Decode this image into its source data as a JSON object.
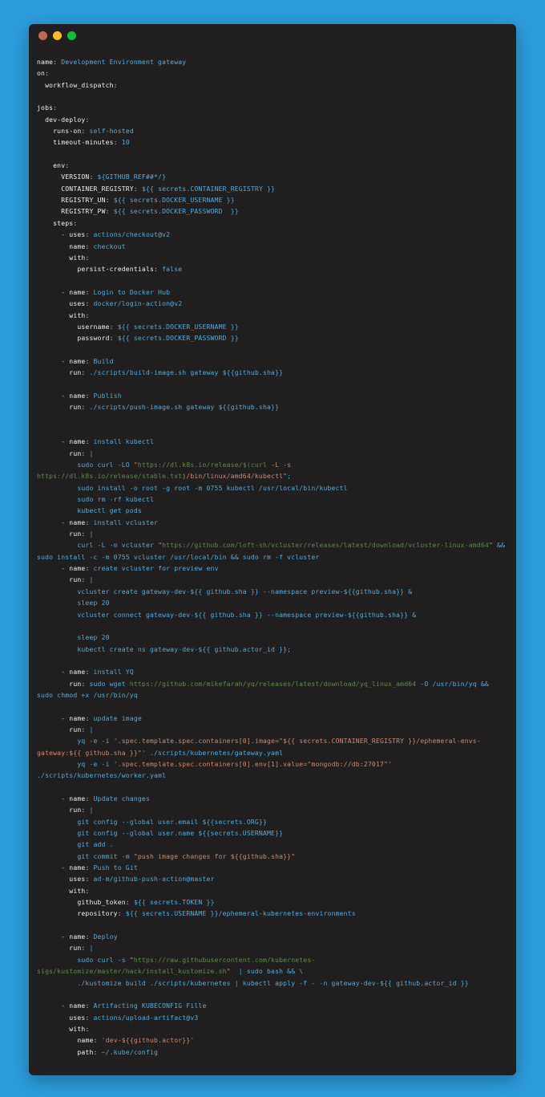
{
  "window": {
    "title": "",
    "traffic_lights": [
      {
        "name": "close-button",
        "color": "#b96a5a"
      },
      {
        "name": "minimize-button",
        "color": "#f5bd1f"
      },
      {
        "name": "maximize-button",
        "color": "#0fbd37"
      }
    ],
    "background_color": "#2d9cdb",
    "code_background_color": "#211f1f"
  },
  "colors": {
    "accent_blue": "#2d9cdb",
    "key": "#e8eef2",
    "value": "#57a8d8",
    "string": "#c98a6f",
    "url": "#5d8a4a",
    "plain": "#b9c2c9"
  },
  "code": {
    "language": "yaml",
    "filename": "",
    "lines": [
      "name: Development Environment gateway",
      "on:",
      "  workflow_dispatch:",
      "",
      "jobs:",
      "  dev-deploy:",
      "    runs-on: self-hosted",
      "    timeout-minutes: 10",
      "",
      "    env:",
      "      VERSION: ${GITHUB_REF##*/}",
      "      CONTAINER_REGISTRY: ${{ secrets.CONTAINER_REGISTRY }}",
      "      REGISTRY_UN: ${{ secrets.DOCKER_USERNAME }}",
      "      REGISTRY_PW: ${{ secrets.DOCKER_PASSWORD  }}",
      "    steps:",
      "      - uses: actions/checkout@v2",
      "        name: checkout",
      "        with:",
      "          persist-credentials: false",
      "",
      "      - name: Login to Docker Hub",
      "        uses: docker/login-action@v2",
      "        with:",
      "          username: ${{ secrets.DOCKER_USERNAME }}",
      "          password: ${{ secrets.DOCKER_PASSWORD }}",
      "",
      "      - name: Build",
      "        run: ./scripts/build-image.sh gateway ${{github.sha}}",
      "",
      "      - name: Publish",
      "        run: ./scripts/push-image.sh gateway ${{github.sha}}",
      "",
      "",
      "      - name: install kubectl",
      "        run: |",
      "          sudo curl -LO \"https://dl.k8s.io/release/$(curl -L -s https://dl.k8s.io/release/stable.txt)/bin/linux/amd64/kubectl\";",
      "          sudo install -o root -g root -m 0755 kubectl /usr/local/bin/kubectl",
      "          sudo rm -rf kubectl",
      "          kubectl get pods",
      "      - name: install vcluster",
      "        run: |",
      "          curl -L -o vcluster \"https://github.com/loft-sh/vcluster/releases/latest/download/vcluster-linux-amd64\" && sudo install -c -m 0755 vcluster /usr/local/bin && sudo rm -f vcluster",
      "      - name: create vcluster for preview env",
      "        run: |",
      "          vcluster create gateway-dev-${{ github.sha }} --namespace preview-${{github.sha}} &",
      "          sleep 20",
      "          vcluster connect gateway-dev-${{ github.sha }} --namespace preview-${{github.sha}} &",
      "",
      "          sleep 20",
      "          kubectl create ns gateway-dev-${{ github.actor_id }};",
      "",
      "      - name: install YQ",
      "        run: sudo wget https://github.com/mikefarah/yq/releases/latest/download/yq_linux_amd64 -O /usr/bin/yq && sudo chmod +x /usr/bin/yq",
      "",
      "      - name: update image",
      "        run: |",
      "          yq -e -i '.spec.template.spec.containers[0].image=\"${{ secrets.CONTAINER_REGISTRY }}/ephemeral-envs-gateway:${{ github.sha }}\"' ./scripts/kubernetes/gateway.yaml",
      "          yq -e -i '.spec.template.spec.containers[0].env[1].value=\"mongodb://db:27017\"' ./scripts/kubernetes/worker.yaml",
      "",
      "      - name: Update changes",
      "        run: |",
      "          git config --global user.email ${{secrets.ORG}}",
      "          git config --global user.name ${{secrets.USERNAME}}",
      "          git add .",
      "          git commit -m \"push image changes for ${{github.sha}}\"",
      "      - name: Push to Git",
      "        uses: ad-m/github-push-action@master",
      "        with:",
      "          github_token: ${{ secrets.TOKEN }}",
      "          repository: ${{ secrets.USERNAME }}/ephemeral-kubernetes-environments",
      "",
      "      - name: Deploy",
      "        run: |",
      "          sudo curl -s \"https://raw.githubusercontent.com/kubernetes-sigs/kustomize/master/hack/install_kustomize.sh\"  | sudo bash && \\",
      "          ./kustomize build ./scripts/kubernetes | kubectl apply -f - -n gateway-dev-${{ github.actor_id }}",
      "",
      "      - name: Artifacting KUBECONFIG Fille",
      "        uses: actions/upload-artifact@v3",
      "        with:",
      "          name: 'dev-${{github.actor}}'",
      "          path: ~/.kube/config"
    ]
  }
}
